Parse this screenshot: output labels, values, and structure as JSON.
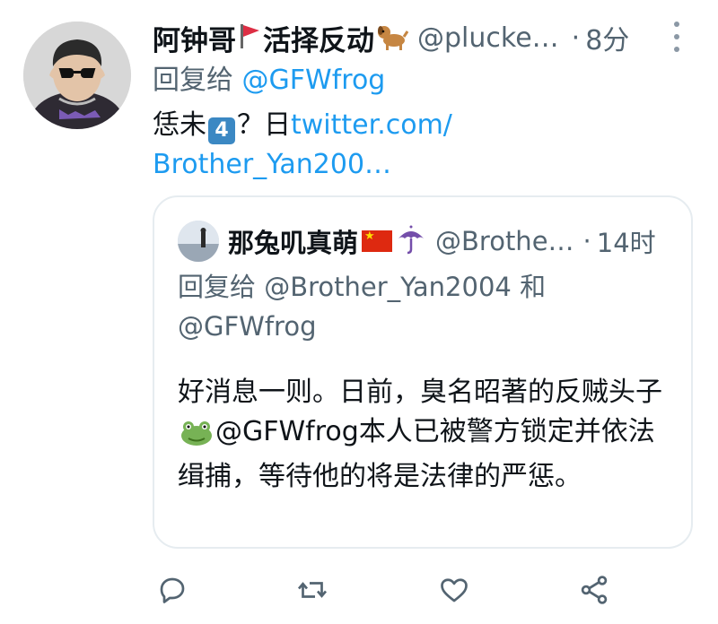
{
  "tweet": {
    "display_name": "阿钟哥",
    "display_name_suffix": "活择反动",
    "handle": "@plucke…",
    "separator": "·",
    "time": "8分",
    "reply_prefix": "回复给",
    "reply_to": "@GFWfrog",
    "text_prefix": "恁未",
    "keycap_digit": "4",
    "text_mid": "？日",
    "link_text_line1": "twitter.com/",
    "link_text_line2": "Brother_Yan200…"
  },
  "quote": {
    "display_name": "那兔叽真萌",
    "handle": "@Brothe…",
    "separator": "·",
    "time": "14时",
    "reply_prefix": "回复给",
    "reply_to_1": "@Brother_Yan2004",
    "reply_and": "和",
    "reply_to_2": "@GFWfrog",
    "text_part1": "好消息一则。日前，臭名昭著的反贼头子",
    "text_mention": "@GFWfrog",
    "text_part2": "本人已被警方锁定并依法缉捕，等待他的将是法律的严惩。"
  },
  "icons": {
    "reply": "reply-icon",
    "retweet": "retweet-icon",
    "like": "heart-icon",
    "share": "share-icon",
    "more": "more-vertical-icon"
  },
  "colors": {
    "link": "#1d9bf0",
    "secondary_text": "#536471",
    "primary_text": "#0f1419",
    "card_border": "#e6ecf0",
    "action_icon": "#536471"
  }
}
